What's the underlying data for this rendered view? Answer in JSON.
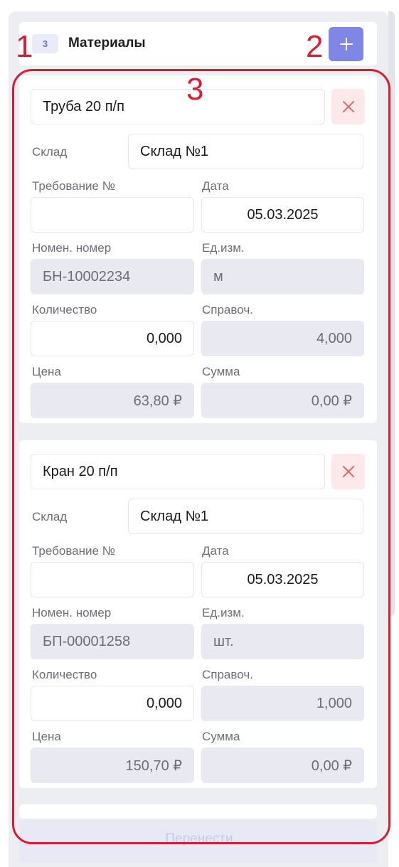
{
  "header": {
    "badge_count": "3",
    "title": "Материалы",
    "add_icon": "plus-icon"
  },
  "labels": {
    "warehouse": "Склад",
    "requirement": "Требование №",
    "date": "Дата",
    "nomenclature": "Номен. номер",
    "unit": "Ед.изм.",
    "quantity": "Количество",
    "reference": "Справоч.",
    "price": "Цена",
    "sum": "Сумма"
  },
  "materials": [
    {
      "name": "Труба 20 п/п",
      "warehouse": "Склад №1",
      "requirement": "",
      "date": "05.03.2025",
      "nomenclature": "БН-10002234",
      "unit": "м",
      "quantity": "0,000",
      "reference": "4,000",
      "price": "63,80 ₽",
      "sum": "0,00 ₽"
    },
    {
      "name": "Кран 20 п/п",
      "warehouse": "Склад №1",
      "requirement": "",
      "date": "05.03.2025",
      "nomenclature": "БП-00001258",
      "unit": "шт.",
      "quantity": "0,000",
      "reference": "1,000",
      "price": "150,70 ₽",
      "sum": "0,00 ₽"
    }
  ],
  "footer": {
    "submit_label": "Перенести"
  },
  "annotations": {
    "n1": "1",
    "n2": "2",
    "n3": "3"
  },
  "colors": {
    "accent": "#7f86e6",
    "remove_bg": "#fde9ea",
    "remove_icon": "#e06a6f",
    "annotation": "#d91d34"
  }
}
